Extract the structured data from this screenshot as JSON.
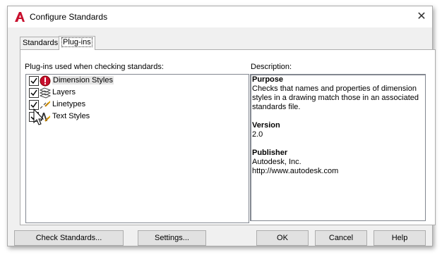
{
  "window": {
    "title": "Configure Standards",
    "close_glyph": "✕"
  },
  "tabs": [
    {
      "label": "Standards",
      "active": false
    },
    {
      "label": "Plug-ins",
      "active": true
    }
  ],
  "plugins": {
    "label": "Plug-ins used when checking standards:",
    "items": [
      {
        "label": "Dimension Styles",
        "checked": true,
        "icon": "dimension-styles-icon"
      },
      {
        "label": "Layers",
        "checked": true,
        "icon": "layers-icon"
      },
      {
        "label": "Linetypes",
        "checked": true,
        "icon": "linetypes-icon"
      },
      {
        "label": "Text Styles",
        "checked": true,
        "icon": "text-styles-icon"
      }
    ]
  },
  "description": {
    "label": "Description:",
    "purpose_heading": "Purpose",
    "purpose_lines": [
      "Checks that names and properties of dimension",
      "styles in a drawing match those in an associated",
      "standards file."
    ],
    "version_heading": "Version",
    "version": "2.0",
    "publisher_heading": "Publisher",
    "publisher": "Autodesk, Inc.",
    "url": "http://www.autodesk.com"
  },
  "buttons": {
    "check_standards": "Check Standards...",
    "settings": "Settings...",
    "ok": "OK",
    "cancel": "Cancel",
    "help": "Help"
  },
  "colors": {
    "brand_red": "#c8102e",
    "accent_blue": "#0078d7"
  }
}
